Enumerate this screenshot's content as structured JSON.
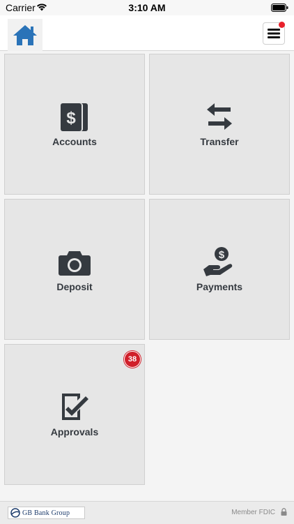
{
  "status_bar": {
    "carrier": "Carrier",
    "time": "3:10 AM"
  },
  "header": {
    "home_icon": "home-icon",
    "menu_icon": "hamburger-menu-icon",
    "notification": true
  },
  "tiles": [
    {
      "label": "Accounts",
      "icon": "accounts-dollar-icon"
    },
    {
      "label": "Transfer",
      "icon": "transfer-arrows-icon"
    },
    {
      "label": "Deposit",
      "icon": "camera-icon"
    },
    {
      "label": "Payments",
      "icon": "hand-dollar-icon"
    },
    {
      "label": "Approvals",
      "icon": "checklist-icon",
      "badge": "38"
    }
  ],
  "footer": {
    "logo_text": "GB Bank Group",
    "member_text": "Member FDIC"
  },
  "colors": {
    "brand_blue": "#2a73b8",
    "badge_red": "#d01f2a",
    "icon_dark": "#353a40"
  }
}
